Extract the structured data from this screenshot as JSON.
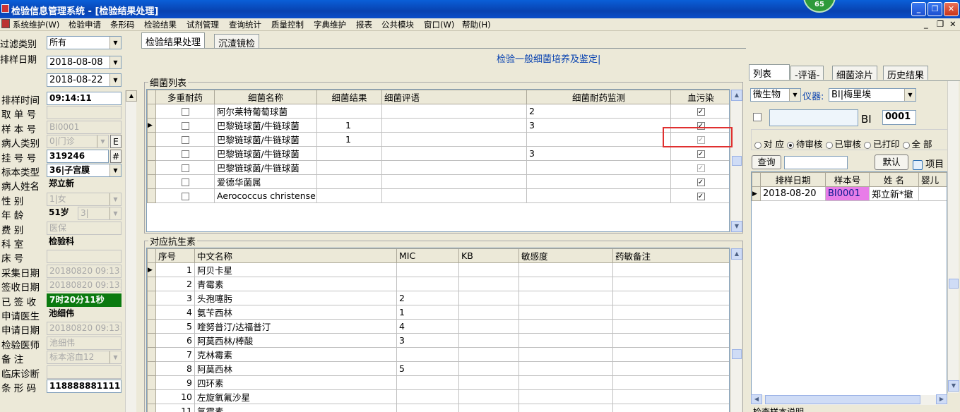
{
  "window": {
    "title": "检验信息管理系统 - [检验结果处理]",
    "badge": "65",
    "min": "_",
    "max": "❐",
    "close": "✕"
  },
  "menu": [
    "系统维护(W)",
    "检验申请",
    "条形码",
    "检验结果",
    "试剂管理",
    "查询统计",
    "质量控制",
    "字典维护",
    "报表",
    "公共模块",
    "窗口(W)",
    "帮助(H)"
  ],
  "mdi": {
    "min": "_",
    "restore": "❐",
    "close": "✕"
  },
  "filter": {
    "type_label": "过滤类别",
    "type_value": "所有",
    "date_label": "排样日期",
    "date_from": "2018-08-08",
    "date_to": "2018-08-22"
  },
  "form": [
    {
      "label": "排样时间",
      "value": "09:14:11",
      "style": "boldwhite"
    },
    {
      "label": "取 单 号",
      "value": "",
      "style": "dis"
    },
    {
      "label": "样 本 号",
      "value": "BI0001",
      "style": "dis"
    },
    {
      "label": "病人类别",
      "value": "0|门诊",
      "style": "dis",
      "extra": "E"
    },
    {
      "label": "挂 号 号",
      "value": "319246",
      "style": "boldwhite",
      "extra": "#"
    },
    {
      "label": "标本类型",
      "value": "36|子宫膜",
      "style": "boldwhite"
    },
    {
      "label": "病人姓名",
      "value": "郑立新",
      "style": "bold"
    },
    {
      "label": "性    别",
      "value": "1|女",
      "style": "dis"
    },
    {
      "label": "年    龄",
      "value": "51岁",
      "style": "bold",
      "extra2": "3|"
    },
    {
      "label": "费    别",
      "value": "医保",
      "style": "dis"
    },
    {
      "label": "科    室",
      "value": "检验科",
      "style": "bold"
    },
    {
      "label": "床    号",
      "value": "",
      "style": "dis"
    },
    {
      "label": "采集日期",
      "value": "20180820 09:13:",
      "style": "dis"
    },
    {
      "label": "签收日期",
      "value": "20180820 09:13:",
      "style": "dis"
    },
    {
      "label": "已 签 收",
      "value": "7时20分11秒",
      "style": "green"
    },
    {
      "label": "申请医生",
      "value": "池细伟",
      "style": "bold"
    },
    {
      "label": "申请日期",
      "value": "20180820 09:13:",
      "style": "dis"
    },
    {
      "label": "检验医师",
      "value": "池细伟",
      "style": "dis"
    },
    {
      "label": "备    注",
      "value": "标本溶血12",
      "style": "dis"
    },
    {
      "label": "临床诊断",
      "value": "",
      "style": "dis"
    },
    {
      "label": "条 形 码",
      "value": "118888881111",
      "style": "boldwhite"
    }
  ],
  "tabs": {
    "main": "检验结果处理",
    "second": "沉渣镜检"
  },
  "section_title": "检验一般细菌培养及鉴定|",
  "bacteria": {
    "group_title": "细菌列表",
    "headers": [
      "多重耐药",
      "细菌名称",
      "细菌结果",
      "细菌评语",
      "细菌耐药监测",
      "血污染"
    ],
    "rows": [
      {
        "multi": false,
        "name": "阿尔莱特葡萄球菌",
        "result": "",
        "comment": "",
        "monitor": "2",
        "blood": true,
        "blood_dim": false,
        "current": false
      },
      {
        "multi": false,
        "name": "巴黎链球菌/牛链球菌",
        "result": "1",
        "comment": "",
        "monitor": "3",
        "blood": true,
        "blood_dim": false,
        "current": true
      },
      {
        "multi": false,
        "name": "巴黎链球菌/牛链球菌",
        "result": "1",
        "comment": "",
        "monitor": "",
        "blood": true,
        "blood_dim": true,
        "current": false
      },
      {
        "multi": false,
        "name": "巴黎链球菌/牛链球菌",
        "result": "",
        "comment": "",
        "monitor": "3",
        "blood": true,
        "blood_dim": false,
        "current": false
      },
      {
        "multi": false,
        "name": "巴黎链球菌/牛链球菌",
        "result": "",
        "comment": "",
        "monitor": "",
        "blood": true,
        "blood_dim": true,
        "current": false
      },
      {
        "multi": false,
        "name": "爱德华菌属",
        "result": "",
        "comment": "",
        "monitor": "",
        "blood": true,
        "blood_dim": false,
        "current": false
      },
      {
        "multi": false,
        "name": "Aerococcus christensenii",
        "result": "",
        "comment": "",
        "monitor": "",
        "blood": true,
        "blood_dim": false,
        "current": false
      }
    ]
  },
  "antibiotics": {
    "group_title": "对应抗生素",
    "headers": [
      "序号",
      "中文名称",
      "MIC",
      "KB",
      "敏感度",
      "药敏备注"
    ],
    "rows": [
      {
        "no": "1",
        "name": "阿贝卡星",
        "mic": "",
        "kb": "",
        "sens": "",
        "note": ""
      },
      {
        "no": "2",
        "name": "青霉素",
        "mic": "",
        "kb": "",
        "sens": "",
        "note": ""
      },
      {
        "no": "3",
        "name": "头孢噻肟",
        "mic": "2",
        "kb": "",
        "sens": "",
        "note": ""
      },
      {
        "no": "4",
        "name": "氨苄西林",
        "mic": "1",
        "kb": "",
        "sens": "",
        "note": ""
      },
      {
        "no": "5",
        "name": "喹努普汀/达福普汀",
        "mic": "4",
        "kb": "",
        "sens": "",
        "note": ""
      },
      {
        "no": "6",
        "name": "阿莫西林/棒酸",
        "mic": "3",
        "kb": "",
        "sens": "",
        "note": ""
      },
      {
        "no": "7",
        "name": "克林霉素",
        "mic": "",
        "kb": "",
        "sens": "",
        "note": ""
      },
      {
        "no": "8",
        "name": "阿莫西林",
        "mic": "5",
        "kb": "",
        "sens": "",
        "note": ""
      },
      {
        "no": "9",
        "name": "四环素",
        "mic": "",
        "kb": "",
        "sens": "",
        "note": ""
      },
      {
        "no": "10",
        "name": "左旋氧氟沙星",
        "mic": "",
        "kb": "",
        "sens": "",
        "note": ""
      },
      {
        "no": "11",
        "name": "氯霉素",
        "mic": "",
        "kb": "",
        "sens": "",
        "note": ""
      }
    ]
  },
  "right": {
    "tabs": [
      "列表",
      "-评语-",
      "细菌涂片",
      "历史结果"
    ],
    "category": "微生物",
    "instrument_label": "仪器:",
    "instrument": "BI|梅里埃",
    "code_prefix": "BI",
    "code": "0001",
    "radios": [
      "对 应",
      "待审核",
      "已审核",
      "已打印",
      "全 部"
    ],
    "radio_selected": 1,
    "query_btn": "查询",
    "default_btn": "默认",
    "item_btn": "项目",
    "list_headers": [
      "排样日期",
      "样本号",
      "姓 名",
      "婴儿"
    ],
    "list_rows": [
      {
        "date": "2018-08-20",
        "sample": "BI0001",
        "name": "郑立新*撤"
      }
    ],
    "footer": "检查样本说明"
  },
  "colors": {
    "title": "#0842b0",
    "highlight": "#e87de8",
    "green": "#0b7a10",
    "red_box": "#e03030"
  }
}
